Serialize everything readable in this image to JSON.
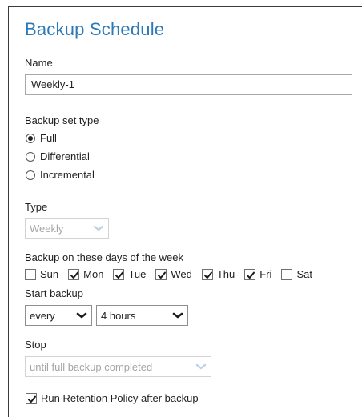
{
  "title": "Backup Schedule",
  "name": {
    "label": "Name",
    "value": "Weekly-1"
  },
  "backup_set_type": {
    "label": "Backup set type",
    "options": [
      {
        "label": "Full",
        "selected": true
      },
      {
        "label": "Differential",
        "selected": false
      },
      {
        "label": "Incremental",
        "selected": false
      }
    ]
  },
  "type": {
    "label": "Type",
    "value": "Weekly",
    "disabled": true
  },
  "days": {
    "label": "Backup on these days of the week",
    "items": [
      {
        "label": "Sun",
        "checked": false
      },
      {
        "label": "Mon",
        "checked": true
      },
      {
        "label": "Tue",
        "checked": true
      },
      {
        "label": "Wed",
        "checked": true
      },
      {
        "label": "Thu",
        "checked": true
      },
      {
        "label": "Fri",
        "checked": true
      },
      {
        "label": "Sat",
        "checked": false
      }
    ]
  },
  "start_backup": {
    "label": "Start backup",
    "frequency": "every",
    "interval": "4 hours"
  },
  "stop": {
    "label": "Stop",
    "value": "until full backup completed",
    "disabled": true
  },
  "retention": {
    "label": "Run Retention Policy after backup",
    "checked": true
  },
  "icons": {
    "dropdown": "chevron-down-icon",
    "checkmark": "checkmark-icon"
  }
}
